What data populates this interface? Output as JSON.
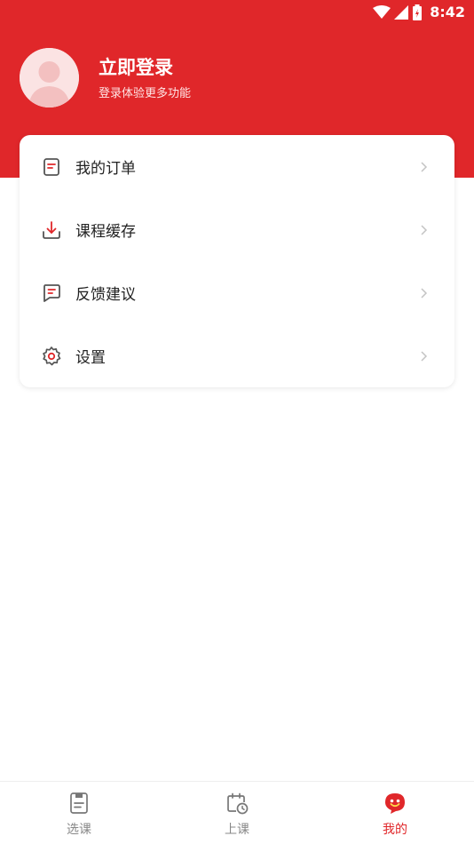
{
  "status_bar": {
    "time": "8:42",
    "icons": [
      "wifi-icon",
      "signal-icon",
      "battery-icon"
    ]
  },
  "profile": {
    "title": "立即登录",
    "subtitle": "登录体验更多功能",
    "avatar_icon": "user-avatar-placeholder"
  },
  "menu": {
    "items": [
      {
        "label": "我的订单",
        "icon": "order-icon"
      },
      {
        "label": "课程缓存",
        "icon": "download-icon"
      },
      {
        "label": "反馈建议",
        "icon": "feedback-icon"
      },
      {
        "label": "设置",
        "icon": "gear-icon"
      }
    ]
  },
  "tabbar": {
    "tabs": [
      {
        "label": "选课",
        "icon": "course-select-icon",
        "active": false
      },
      {
        "label": "上课",
        "icon": "calendar-clock-icon",
        "active": false
      },
      {
        "label": "我的",
        "icon": "mine-icon",
        "active": true
      }
    ]
  },
  "colors": {
    "brand": "#e0272a",
    "text": "#222222",
    "muted": "#888888"
  }
}
